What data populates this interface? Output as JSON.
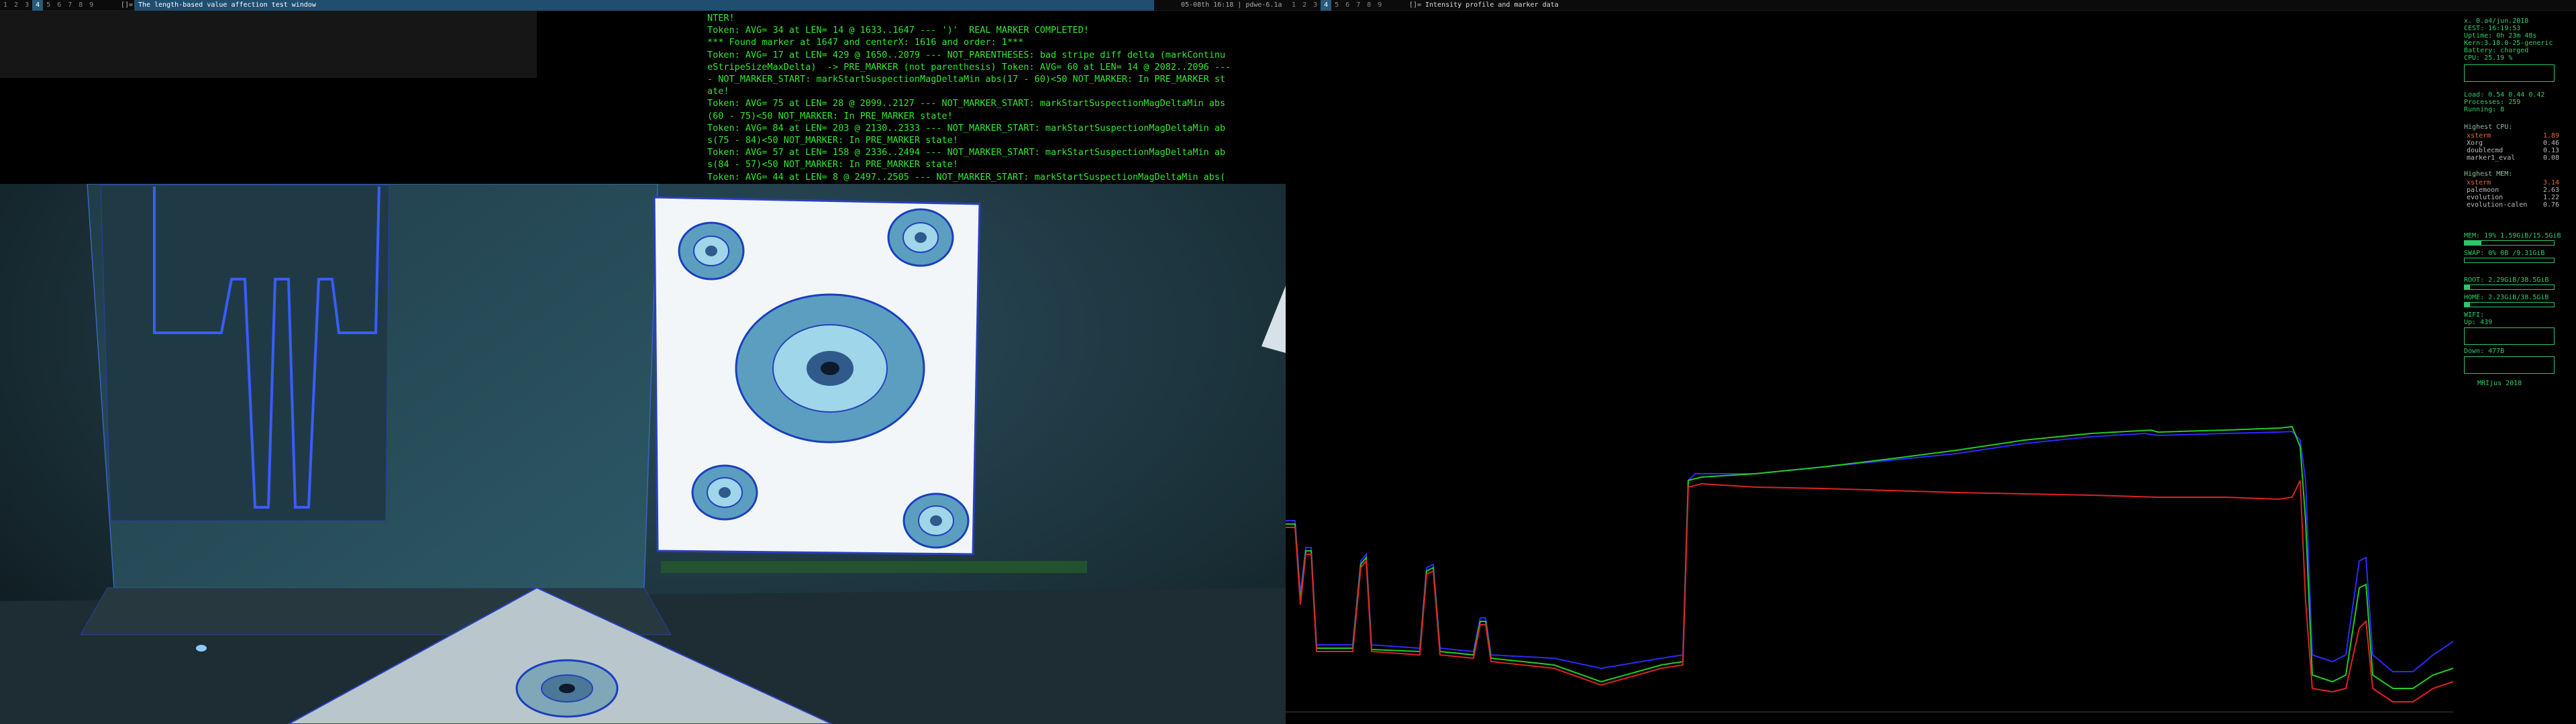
{
  "topbar": {
    "left_workspaces": [
      "1",
      "2",
      "3",
      "4",
      "5",
      "6",
      "7",
      "8",
      "9"
    ],
    "left_active_workspace": "4",
    "left_layout": "[]=",
    "left_window_title": "The length-based value affection test window",
    "clock": "05-08th 16:18 | pdwe-6.1a",
    "right_workspaces": [
      "1",
      "2",
      "3",
      "4",
      "5",
      "6",
      "7",
      "8",
      "9"
    ],
    "right_active_workspace": "4",
    "right_layout": "[]=",
    "right_window_title": "Intensity profile and marker data"
  },
  "terminal": {
    "lines": [
      "NTER!",
      "Token: AVG= 34 at LEN= 14 @ 1633..1647 --- ')'  REAL MARKER COMPLETED!",
      "*** Found marker at 1647 and centerX: 1616 and order: 1***",
      "Token: AVG= 17 at LEN= 429 @ 1650..2079 --- NOT_PARENTHESES: bad stripe diff delta (markContinu",
      "eStripeSizeMaxDelta)  -> PRE_MARKER (not parenthesis) Token: AVG= 60 at LEN= 14 @ 2082..2096 ---",
      "- NOT_MARKER_START: markStartSuspectionMagDeltaMin abs(17 - 60)<50 NOT_MARKER: In PRE_MARKER st",
      "ate!",
      "Token: AVG= 75 at LEN= 28 @ 2099..2127 --- NOT_MARKER_START: markStartSuspectionMagDeltaMin abs",
      "(60 - 75)<50 NOT_MARKER: In PRE_MARKER state!",
      "Token: AVG= 84 at LEN= 203 @ 2130..2333 --- NOT_MARKER_START: markStartSuspectionMagDeltaMin ab",
      "s(75 - 84)<50 NOT_MARKER: In PRE_MARKER state!",
      "Token: AVG= 57 at LEN= 158 @ 2336..2494 --- NOT_MARKER_START: markStartSuspectionMagDeltaMin ab",
      "s(84 - 57)<50 NOT_MARKER: In PRE_MARKER state!",
      "Token: AVG= 44 at LEN= 8 @ 2497..2505 --- NOT_MARKER_START: markStartSuspectionMagDeltaMin abs("
    ]
  },
  "conky": {
    "header_lines": [
      "x.  0.a4/jun.2018",
      "CEST:   16:19:53",
      "Uptime: 0h 23m 48s",
      "Kern:3.18.0-25-generic",
      "Battery:   charged",
      "CPU: 25.19 %"
    ],
    "load": "Load: 0.54 0.44 0.42",
    "processes": "Processes: 259",
    "running": "Running:   8",
    "highest_cpu_title": "Highest CPU:",
    "cpu_top": [
      {
        "name": "xsterm",
        "value": "1.89"
      },
      {
        "name": "Xorg",
        "value": "0.46"
      },
      {
        "name": "doublecmd",
        "value": "0.13"
      },
      {
        "name": "marker1_eval",
        "value": "0.08"
      }
    ],
    "highest_mem_title": "Highest MEM:",
    "mem_top": [
      {
        "name": "xsterm",
        "value": "3.14"
      },
      {
        "name": "palemoon",
        "value": "2.63"
      },
      {
        "name": "evolution",
        "value": "1.22"
      },
      {
        "name": "evolution-calen",
        "value": "0.76"
      }
    ],
    "mem": "MEM:  19% 1.59GiB/15.5GiB",
    "swap": "SWAP: 0% 0B    /9.31GiB",
    "root": "ROOT:  2.29GiB/38.5GiB",
    "home": "HOME:  2.23GiB/38.5GiB",
    "wifi": "WIFI:",
    "up": "Up: 439",
    "down": "Down: 477B",
    "footer": "MRIjus 2018",
    "cpu_fraction": 0.25,
    "mem_fraction": 0.19,
    "swap_fraction": 0.0,
    "root_fraction": 0.06,
    "home_fraction": 0.06
  },
  "colors": {
    "terminal_text": "#32e832",
    "conky_accent": "#2dc66a",
    "active_title": "#1f4e6f"
  }
}
